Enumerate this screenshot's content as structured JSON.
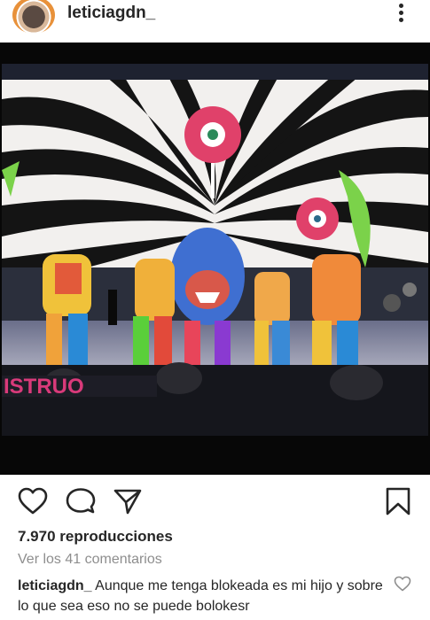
{
  "post": {
    "username": "leticiagdn_",
    "views": "7.970 reproducciones",
    "comments_link": "Ver los 41 comentarios",
    "caption_user": "leticiagdn_",
    "caption_text": " Aunque me tenga blokeada es mi hijo y sobre lo que sea eso no se puede bolokesr"
  },
  "media": {
    "screen_text": "ISTRUO"
  },
  "icons": {
    "avatar": "profile-avatar",
    "more": "more-options-icon",
    "like": "heart-icon",
    "comment": "comment-icon",
    "share": "share-icon",
    "save": "bookmark-icon",
    "comment_like": "heart-small-icon"
  },
  "colors": {
    "text": "#262626",
    "muted": "#8e8e8e",
    "background": "#ffffff"
  }
}
